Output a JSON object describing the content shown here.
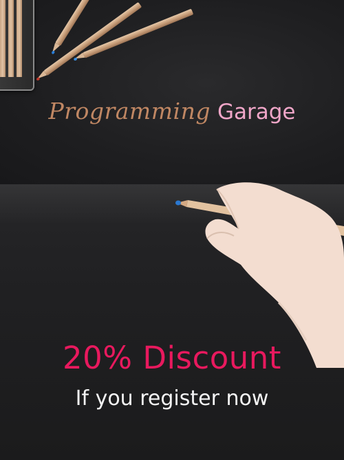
{
  "brand": {
    "primary": "Programming",
    "secondary": "Garage"
  },
  "promo": {
    "headline": "20% Discount",
    "subline": "If you register now"
  },
  "colors": {
    "background": "#1c1c1d",
    "brand_primary": "#c08763",
    "brand_secondary": "#f0a6c8",
    "headline": "#e8195e",
    "subline": "#f4f4f4"
  },
  "imagery": {
    "top": "colored-pencils-on-dark-surface",
    "bottom": "hand-holding-pencil"
  }
}
